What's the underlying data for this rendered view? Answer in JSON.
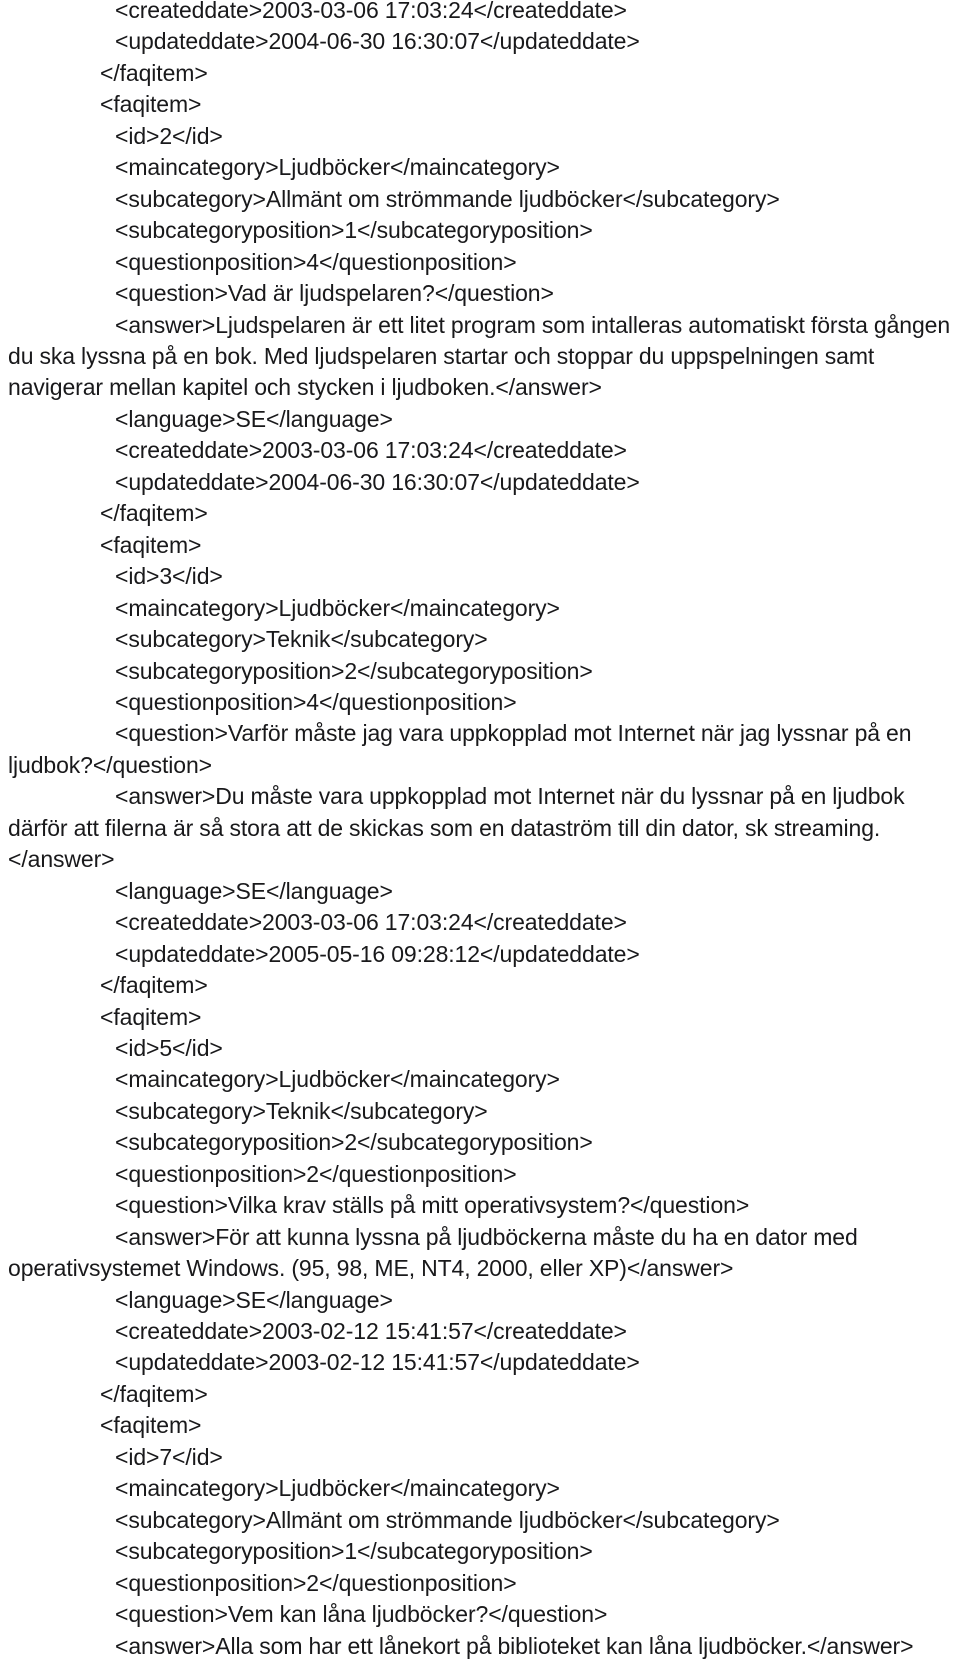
{
  "document": {
    "kind": "xml-source-listing",
    "language_of_content": "sv-SE",
    "root_element": "faqitem",
    "background_color": "#ffffff",
    "text_color": "#19191b",
    "lines": [
      {
        "indent": 2,
        "text": "<createddate>2003-03-06 17:03:24</createddate>"
      },
      {
        "indent": 2,
        "text": "<updateddate>2004-06-30 16:30:07</updateddate>"
      },
      {
        "indent": 1,
        "text": "</faqitem>"
      },
      {
        "indent": 1,
        "text": "<faqitem>"
      },
      {
        "indent": 2,
        "text": "<id>2</id>"
      },
      {
        "indent": 2,
        "text": "<maincategory>Ljudböcker</maincategory>"
      },
      {
        "indent": 2,
        "text": "<subcategory>Allmänt om strömmande ljudböcker</subcategory>"
      },
      {
        "indent": 2,
        "text": "<subcategoryposition>1</subcategoryposition>"
      },
      {
        "indent": 2,
        "text": "<questionposition>4</questionposition>"
      },
      {
        "indent": 2,
        "text": "<question>Vad är ljudspelaren?</question>"
      },
      {
        "indent": 2,
        "text": "<answer>Ljudspelaren är ett litet program som intalleras automatiskt första gången du ska lyssna på en bok. Med ljudspelaren startar och stoppar du uppspelningen samt navigerar mellan kapitel och stycken i ljudboken.</answer>"
      },
      {
        "indent": 2,
        "text": "<language>SE</language>"
      },
      {
        "indent": 2,
        "text": "<createddate>2003-03-06 17:03:24</createddate>"
      },
      {
        "indent": 2,
        "text": "<updateddate>2004-06-30 16:30:07</updateddate>"
      },
      {
        "indent": 1,
        "text": "</faqitem>"
      },
      {
        "indent": 1,
        "text": "<faqitem>"
      },
      {
        "indent": 2,
        "text": "<id>3</id>"
      },
      {
        "indent": 2,
        "text": "<maincategory>Ljudböcker</maincategory>"
      },
      {
        "indent": 2,
        "text": "<subcategory>Teknik</subcategory>"
      },
      {
        "indent": 2,
        "text": "<subcategoryposition>2</subcategoryposition>"
      },
      {
        "indent": 2,
        "text": "<questionposition>4</questionposition>"
      },
      {
        "indent": 2,
        "text": "<question>Varför måste jag vara uppkopplad mot Internet när jag lyssnar på en ljudbok?</question>"
      },
      {
        "indent": 2,
        "text": "<answer>Du måste vara uppkopplad mot Internet när du lyssnar på en ljudbok därför att filerna är så stora att de skickas som en dataström till din dator, sk streaming.</answer>"
      },
      {
        "indent": 2,
        "text": "<language>SE</language>"
      },
      {
        "indent": 2,
        "text": "<createddate>2003-03-06 17:03:24</createddate>"
      },
      {
        "indent": 2,
        "text": "<updateddate>2005-05-16 09:28:12</updateddate>"
      },
      {
        "indent": 1,
        "text": "</faqitem>"
      },
      {
        "indent": 1,
        "text": "<faqitem>"
      },
      {
        "indent": 2,
        "text": "<id>5</id>"
      },
      {
        "indent": 2,
        "text": "<maincategory>Ljudböcker</maincategory>"
      },
      {
        "indent": 2,
        "text": "<subcategory>Teknik</subcategory>"
      },
      {
        "indent": 2,
        "text": "<subcategoryposition>2</subcategoryposition>"
      },
      {
        "indent": 2,
        "text": "<questionposition>2</questionposition>"
      },
      {
        "indent": 2,
        "text": "<question>Vilka krav ställs på mitt operativsystem?</question>"
      },
      {
        "indent": 2,
        "text": "<answer>För att kunna lyssna på ljudböckerna måste du ha en dator med operativsystemet Windows. (95, 98, ME, NT4, 2000, eller XP)</answer>"
      },
      {
        "indent": 2,
        "text": "<language>SE</language>"
      },
      {
        "indent": 2,
        "text": "<createddate>2003-02-12 15:41:57</createddate>"
      },
      {
        "indent": 2,
        "text": "<updateddate>2003-02-12 15:41:57</updateddate>"
      },
      {
        "indent": 1,
        "text": "</faqitem>"
      },
      {
        "indent": 1,
        "text": "<faqitem>"
      },
      {
        "indent": 2,
        "text": "<id>7</id>"
      },
      {
        "indent": 2,
        "text": "<maincategory>Ljudböcker</maincategory>"
      },
      {
        "indent": 2,
        "text": "<subcategory>Allmänt om strömmande ljudböcker</subcategory>"
      },
      {
        "indent": 2,
        "text": "<subcategoryposition>1</subcategoryposition>"
      },
      {
        "indent": 2,
        "text": "<questionposition>2</questionposition>"
      },
      {
        "indent": 2,
        "text": "<question>Vem kan låna ljudböcker?</question>"
      },
      {
        "indent": 2,
        "text": "<answer>Alla som har ett lånekort på biblioteket kan låna ljudböcker.</answer>"
      }
    ]
  }
}
